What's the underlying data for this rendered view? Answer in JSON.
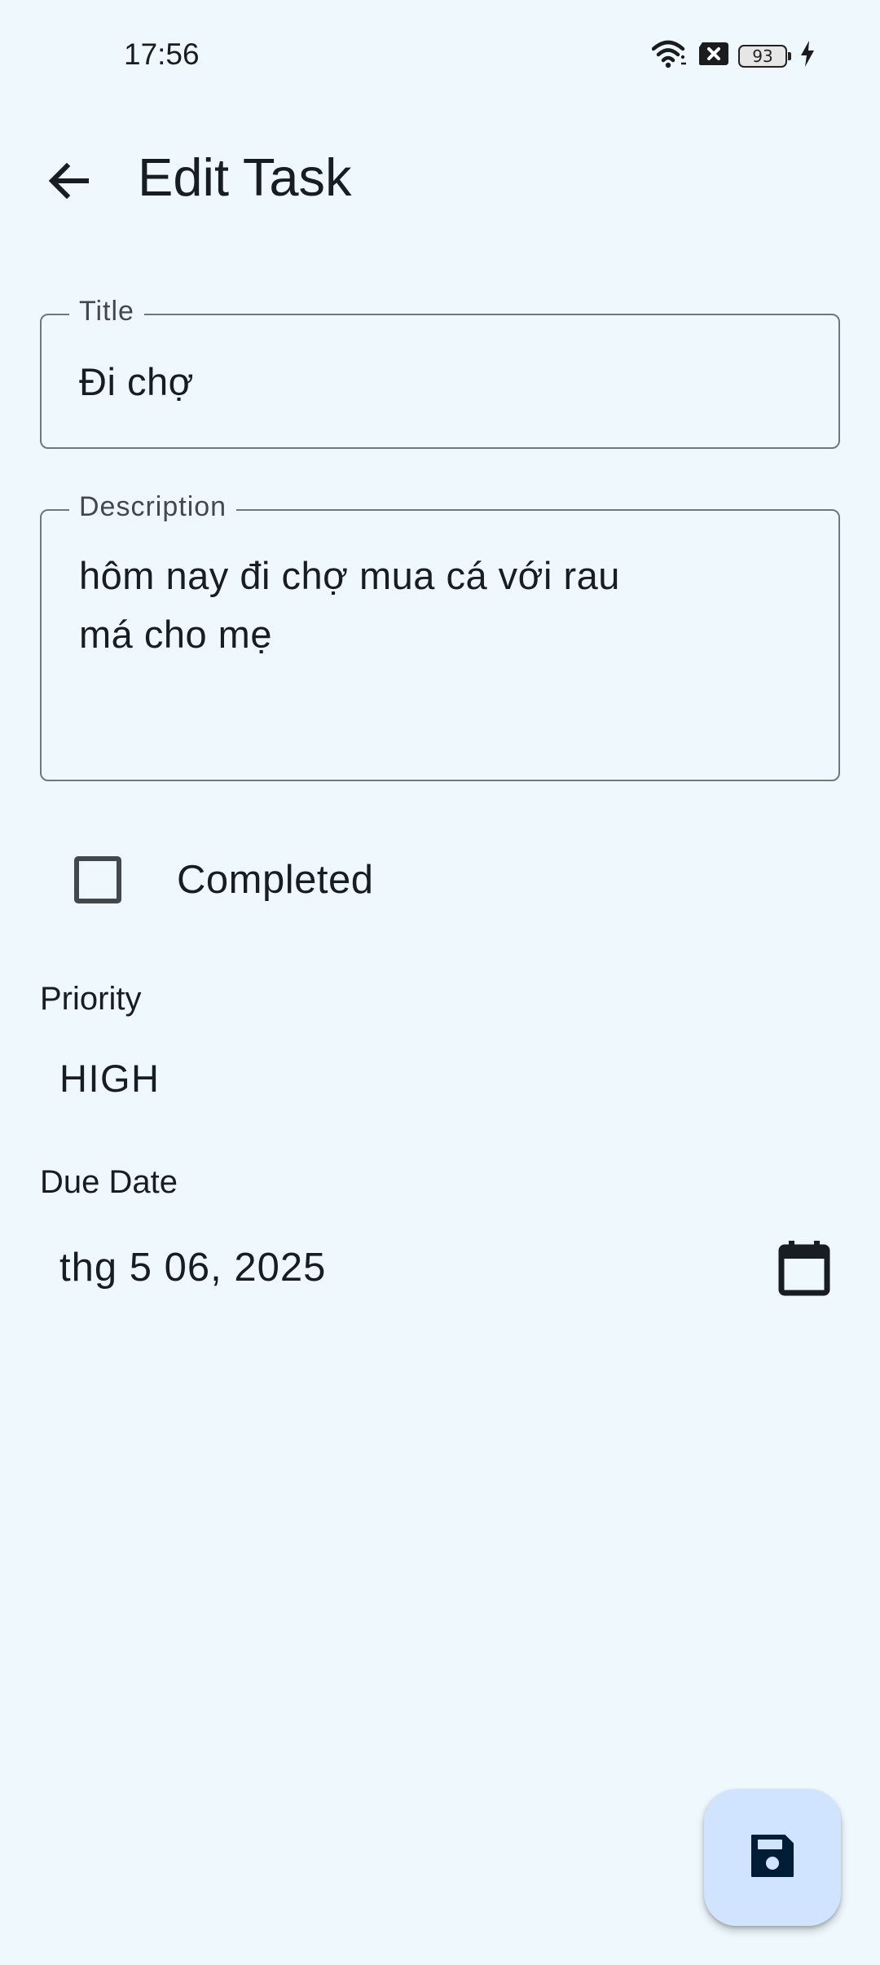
{
  "status_bar": {
    "time": "17:56",
    "battery_level": "93",
    "icons": [
      "wifi-icon",
      "sim-off-icon",
      "battery-icon",
      "charging-icon"
    ]
  },
  "app_bar": {
    "title": "Edit Task",
    "back_icon": "arrow-back-icon"
  },
  "form": {
    "title_field": {
      "label": "Title",
      "value": "Đi chợ"
    },
    "description_field": {
      "label": "Description",
      "value": "hôm nay đi chợ mua cá với rau\nmá cho mẹ"
    },
    "completed": {
      "label": "Completed",
      "checked": false
    },
    "priority": {
      "label": "Priority",
      "value": "HIGH"
    },
    "due_date": {
      "label": "Due Date",
      "value": "thg 5 06, 2025",
      "icon": "calendar-icon"
    }
  },
  "fab": {
    "icon": "save-icon"
  },
  "colors": {
    "background": "#eff9fd",
    "text": "#171d22",
    "outline": "#6f7880",
    "fab_container": "#d0e4ff",
    "fab_icon": "#001d36"
  }
}
